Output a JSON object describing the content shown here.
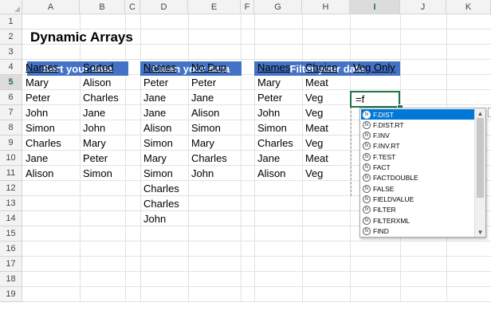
{
  "columns": [
    "A",
    "B",
    "C",
    "D",
    "E",
    "F",
    "G",
    "H",
    "I",
    "J",
    "K"
  ],
  "rows": [
    "1",
    "2",
    "3",
    "4",
    "5",
    "6",
    "7",
    "8",
    "9",
    "10",
    "11",
    "12",
    "13",
    "14",
    "15",
    "16",
    "17",
    "18",
    "19"
  ],
  "active_column": "I",
  "active_row": "5",
  "title": "Dynamic Arrays",
  "sections": {
    "sort": {
      "banner": "Sort your data",
      "headers": [
        "Names",
        "Sorted"
      ],
      "names": [
        "Mary",
        "Peter",
        "John",
        "Simon",
        "Charles",
        "Jane",
        "Alison"
      ],
      "sorted": [
        "Alison",
        "Charles",
        "Jane",
        "John",
        "Mary",
        "Peter",
        "Simon"
      ]
    },
    "clean": {
      "banner": "Clean your data",
      "headers": [
        "Names",
        "No Dup"
      ],
      "names": [
        "Peter",
        "Jane",
        "Jane",
        "Alison",
        "Simon",
        "Mary",
        "Simon",
        "Charles",
        "Charles",
        "John"
      ],
      "nodup": [
        "Peter",
        "Jane",
        "Alison",
        "Simon",
        "Mary",
        "Charles",
        "John"
      ]
    },
    "filter": {
      "banner": "Filter your data",
      "headers": [
        "Names",
        "Choice",
        "Veg Only"
      ],
      "names": [
        "Mary",
        "Peter",
        "John",
        "Simon",
        "Charles",
        "Jane",
        "Alison"
      ],
      "choice": [
        "Meat",
        "Veg",
        "Veg",
        "Meat",
        "Veg",
        "Meat",
        "Veg"
      ]
    }
  },
  "formula_input": "=f",
  "autocomplete": {
    "items": [
      "F.DIST",
      "F.DIST.RT",
      "F.INV",
      "F.INV.RT",
      "F.TEST",
      "FACT",
      "FACTDOUBLE",
      "FALSE",
      "FIELDVALUE",
      "FILTER",
      "FILTERXML",
      "FIND"
    ],
    "selected_index": 0,
    "icon": "function-icon"
  },
  "colors": {
    "banner": "#4472c4",
    "selection": "#217346",
    "highlight": "#0078d7"
  }
}
